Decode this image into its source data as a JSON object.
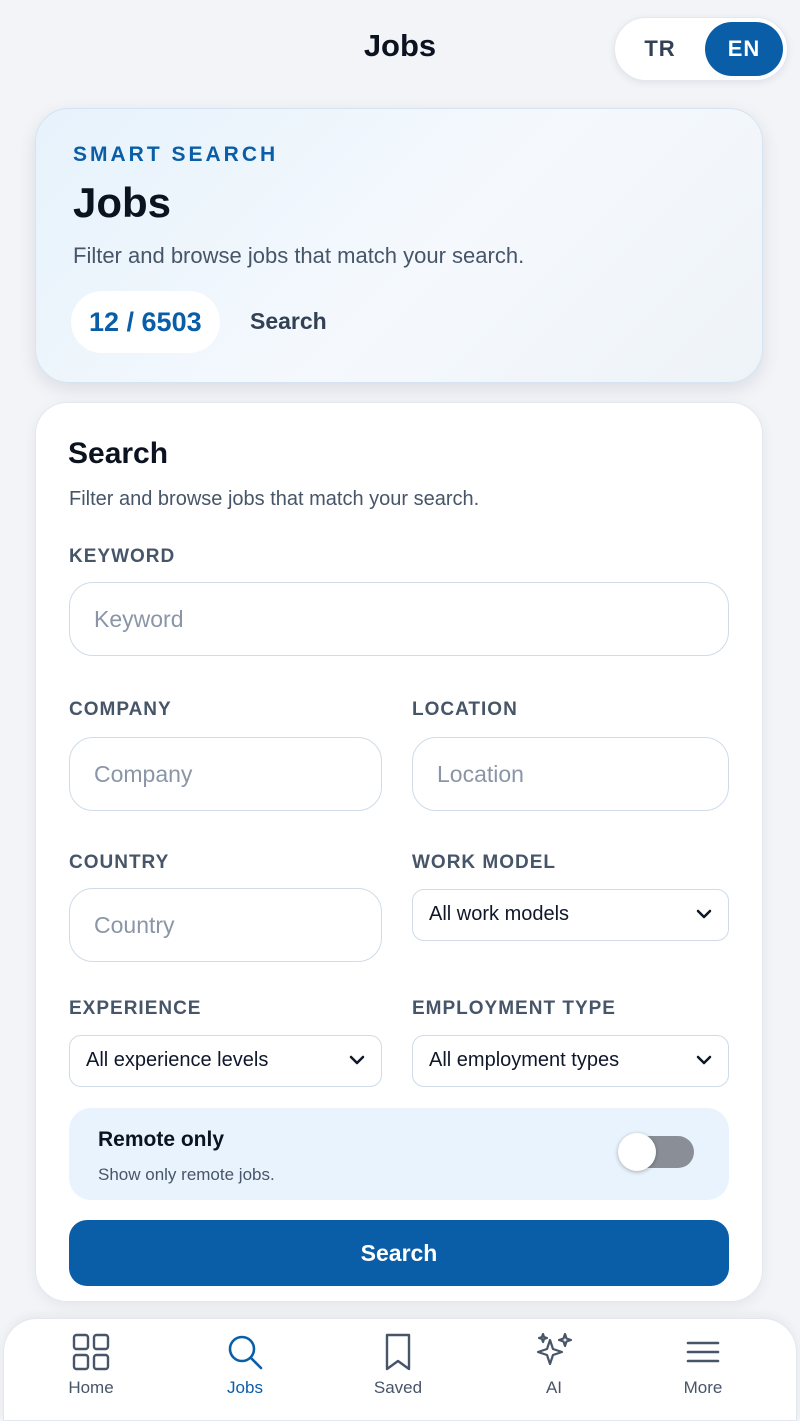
{
  "header": {
    "title": "Jobs"
  },
  "language": {
    "options": [
      "TR",
      "EN"
    ],
    "selected": "EN"
  },
  "hero": {
    "eyebrow": "SMART SEARCH",
    "title": "Jobs",
    "description": "Filter and browse jobs that match your search.",
    "count": "12 / 6503",
    "count_label": "Search"
  },
  "search_panel": {
    "title": "Search",
    "description": "Filter and browse jobs that match your search.",
    "keyword": {
      "label": "KEYWORD",
      "placeholder": "Keyword",
      "value": ""
    },
    "company": {
      "label": "COMPANY",
      "placeholder": "Company",
      "value": ""
    },
    "location": {
      "label": "LOCATION",
      "placeholder": "Location",
      "value": ""
    },
    "country": {
      "label": "COUNTRY",
      "placeholder": "Country",
      "value": ""
    },
    "work_model": {
      "label": "WORK MODEL",
      "selected": "All work models"
    },
    "experience": {
      "label": "EXPERIENCE",
      "selected": "All experience levels"
    },
    "employment_type": {
      "label": "EMPLOYMENT TYPE",
      "selected": "All employment types"
    },
    "remote": {
      "title": "Remote only",
      "description": "Show only remote jobs.",
      "enabled": false
    },
    "submit_label": "Search"
  },
  "nav": {
    "items": [
      {
        "label": "Home",
        "icon": "grid-icon",
        "active": false
      },
      {
        "label": "Jobs",
        "icon": "search-icon",
        "active": true
      },
      {
        "label": "Saved",
        "icon": "bookmark-icon",
        "active": false
      },
      {
        "label": "AI",
        "icon": "sparkles-icon",
        "active": false
      },
      {
        "label": "More",
        "icon": "menu-icon",
        "active": false
      }
    ]
  },
  "colors": {
    "accent": "#0a5ea8",
    "background": "#f2f4f8",
    "muted_text": "#475569"
  }
}
